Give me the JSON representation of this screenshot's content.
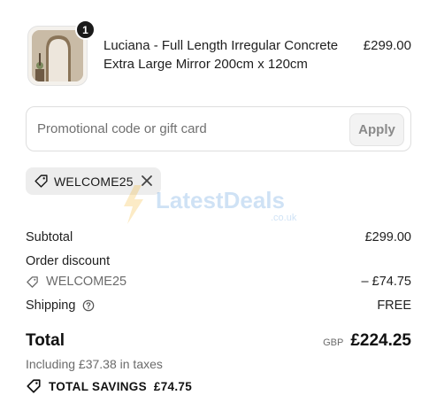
{
  "line_item": {
    "quantity": "1",
    "name": "Luciana - Full Length Irregular Concrete Extra Large Mirror 200cm x 120cm",
    "price": "£299.00",
    "image_icon": "mirror-product-image"
  },
  "promo": {
    "placeholder": "Promotional code or gift card",
    "value": "",
    "apply_label": "Apply"
  },
  "applied_code": {
    "code": "WELCOME25",
    "tag_icon": "tag-icon",
    "remove_icon": "close-icon"
  },
  "watermark": {
    "text": "LatestDeals",
    "sub": ".co.uk"
  },
  "summary": {
    "subtotal_label": "Subtotal",
    "subtotal_value": "£299.00",
    "discount_label": "Order discount",
    "discount_code": "WELCOME25",
    "discount_value": "– £74.75",
    "shipping_label": "Shipping",
    "shipping_value": "FREE",
    "total_label": "Total",
    "currency": "GBP",
    "total_value": "£224.25",
    "taxes": "Including £37.38 in taxes",
    "savings_label": "TOTAL SAVINGS",
    "savings_value": "£74.75"
  },
  "colors": {
    "text": "#1f1f1f",
    "muted": "#6b6b6b",
    "chip_bg": "#ededed",
    "border": "#dedede"
  }
}
